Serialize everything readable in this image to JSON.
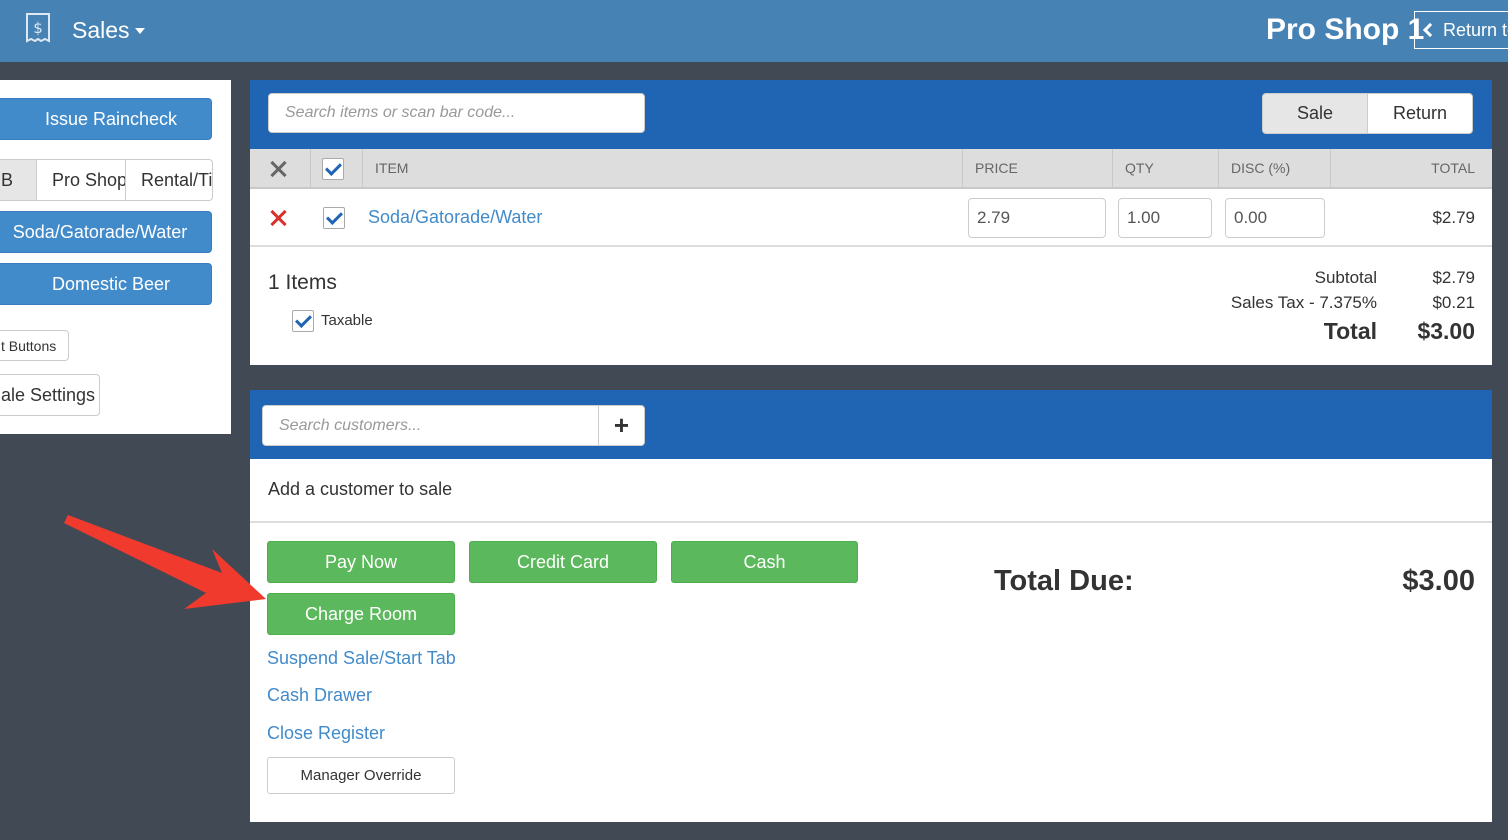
{
  "header": {
    "app_icon": "receipt-dollar-icon",
    "app_title": "Sales",
    "shop_title": "Pro Shop 1",
    "return_label": "Return to"
  },
  "left_panel": {
    "issue_raincheck": "Issue Raincheck",
    "categories": [
      {
        "label": "B",
        "selected": true
      },
      {
        "label": "Pro Shop",
        "selected": false
      },
      {
        "label": "Rental/Ti",
        "selected": false
      }
    ],
    "quick_items": [
      "Soda/Gatorade/Water",
      "Domestic Beer"
    ],
    "buttons_label": "t Buttons",
    "settings_label": "ale Settings"
  },
  "sales": {
    "search_placeholder": "Search items or scan bar code...",
    "mode_sale": "Sale",
    "mode_return": "Return",
    "columns": {
      "item": "ITEM",
      "price": "PRICE",
      "qty": "QTY",
      "disc": "DISC (%)",
      "total": "TOTAL"
    },
    "rows": [
      {
        "item": "Soda/Gatorade/Water",
        "price": "2.79",
        "qty": "1.00",
        "disc": "0.00",
        "total": "$2.79"
      }
    ],
    "items_count": "1 Items",
    "taxable_label": "Taxable",
    "subtotal_label": "Subtotal",
    "subtotal": "$2.79",
    "tax_label": "Sales Tax - 7.375%",
    "tax": "$0.21",
    "total_label": "Total",
    "total": "$3.00"
  },
  "customer": {
    "search_placeholder": "Search customers...",
    "add_symbol": "+",
    "empty_message": "Add a customer to sale"
  },
  "payment": {
    "pay_now": "Pay Now",
    "credit_card": "Credit Card",
    "cash": "Cash",
    "charge_room": "Charge Room",
    "suspend": "Suspend Sale/Start Tab",
    "cash_drawer": "Cash Drawer",
    "close_register": "Close Register",
    "manager_override": "Manager Override",
    "total_due_label": "Total Due:",
    "total_due": "$3.00"
  },
  "colors": {
    "topbar": "#4682b4",
    "panel_header": "#1f65b4",
    "background": "#414a54",
    "primary_button": "#428bca",
    "pay_button": "#5cb85c",
    "remove_icon": "#d9302c",
    "annotation_arrow": "#f03a2e"
  }
}
